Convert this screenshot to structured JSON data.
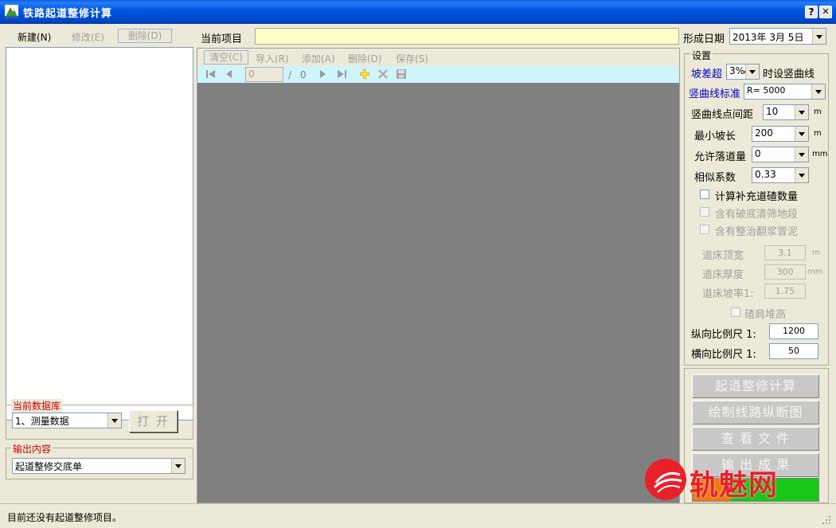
{
  "window": {
    "title": "铁路起道整修计算",
    "help_label": "?",
    "close_label": "✕"
  },
  "left": {
    "toolbar": {
      "new": "新建(N)",
      "edit": "修改(E)",
      "delete": "删除(D)"
    },
    "db_group": {
      "title": "当前数据库",
      "selected": "1、测量数据",
      "open_button": "打 开"
    },
    "output_group": {
      "title": "输出内容",
      "selected": "起道整修交底单"
    }
  },
  "center": {
    "project_label": "当前项目",
    "project_value": "",
    "toolbar": {
      "clear": "清空(C)",
      "import": "导入(R)",
      "add": "添加(A)",
      "delete": "删除(D)",
      "save": "保存(S)"
    },
    "nav": {
      "record": "0",
      "separator": "/",
      "total": "0"
    }
  },
  "right": {
    "date_label": "形成日期",
    "date_value": "2013年  3月  5日",
    "settings": {
      "title": "设置",
      "slope_label": "坡差超",
      "slope_value": "3‰",
      "slope_suffix": "时设竖曲线",
      "curve_std_label": "竖曲线标准",
      "curve_std_value": "R=  5000",
      "point_spacing_label": "竖曲线点间距",
      "point_spacing_value": "10",
      "point_spacing_unit": "m",
      "min_slope_label": "最小坡长",
      "min_slope_value": "200",
      "min_slope_unit": "m",
      "allow_drop_label": "允许落道量",
      "allow_drop_value": "0",
      "allow_drop_unit": "mm",
      "similarity_label": "相似系数",
      "similarity_value": "0.33",
      "cb_supplement": "计算补充道碴数量",
      "cb_broken": "含有破底清筛地段",
      "cb_mud": "含有整治翻浆冒泥",
      "bed_width_label": "道床顶宽",
      "bed_width_value": "3.1",
      "bed_width_unit": "m",
      "bed_thick_label": "道床厚度",
      "bed_thick_value": "300",
      "bed_thick_unit": "mm",
      "bed_slope_label": "道床坡率1:",
      "bed_slope_value": "1.75",
      "shoulder_label": "碴肩堆高",
      "vscale_label": "纵向比例尺  1:",
      "vscale_value": "1200",
      "hscale_label": "横向比例尺  1:",
      "hscale_value": "50"
    },
    "buttons": {
      "calc": "起道整修计算",
      "draw": "绘制线路纵断图",
      "view": "查 看 文 件",
      "output": "输 出 成 果"
    }
  },
  "watermark": {
    "text": "轨魅网"
  },
  "status": {
    "message": "目前还没有起道整修项目。"
  }
}
